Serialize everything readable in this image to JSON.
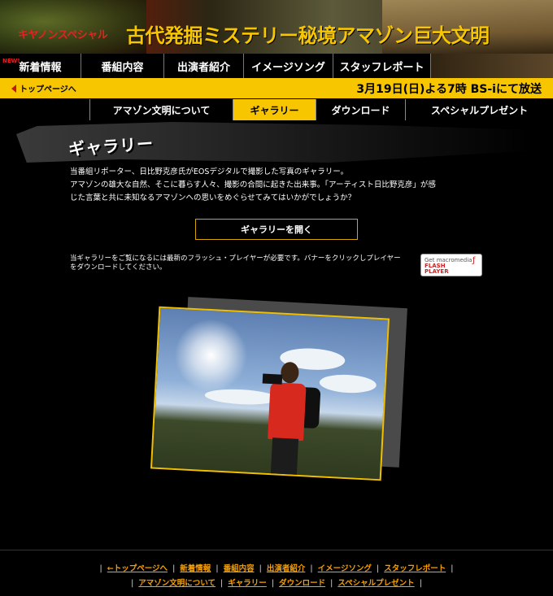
{
  "header": {
    "brand": "キヤノンスペシャル",
    "title": "古代発掘ミステリー秘境アマゾン巨大文明"
  },
  "top_nav": {
    "new_badge": "NEW!",
    "items": [
      "新着情報",
      "番組内容",
      "出演者紹介",
      "イメージソング",
      "スタッフレポート"
    ]
  },
  "yellow_bar": {
    "back_link": "トップページへ",
    "broadcast": "3月19日(日)よる7時 BS-iにて放送"
  },
  "sub_nav": {
    "tabs": [
      "アマゾン文明について",
      "ギャラリー",
      "ダウンロード",
      "スペシャルプレゼント"
    ],
    "active": "ギャラリー"
  },
  "gallery": {
    "heading": "ギャラリー",
    "desc_lines": [
      "当番組リポーター、日比野克彦氏がEOSデジタルで撮影した写真のギャラリー。",
      "アマゾンの雄大な自然、そこに暮らす人々、撮影の合間に起きた出来事。「アーティスト日比野克彦」が感",
      "じた言葉と共に未知なるアマゾンへの思いをめぐらせてみてはいかがでしょうか？"
    ],
    "open_button": "ギャラリーを開く",
    "flash_note_lines": [
      "当ギャラリーをご覧になるには最新のフラッシュ・プレイヤーが必要です。バナーをクリックしプレイヤー",
      "をダウンロードしてください。"
    ],
    "flash_badge": {
      "line1": "Get macromedia",
      "line2": "FLASH",
      "line3": "PLAYER"
    }
  },
  "footer": {
    "row1": [
      "←トップページへ",
      "新着情報",
      "番組内容",
      "出演者紹介",
      "イメージソング",
      "スタッフレポート"
    ],
    "row2": [
      "アマゾン文明について",
      "ギャラリー",
      "ダウンロード",
      "スペシャルプレゼント"
    ],
    "separator": "|"
  },
  "colors": {
    "accent_yellow": "#f7c600",
    "brand_red": "#e8201e",
    "link_orange": "#f7a000",
    "background": "#000000"
  }
}
